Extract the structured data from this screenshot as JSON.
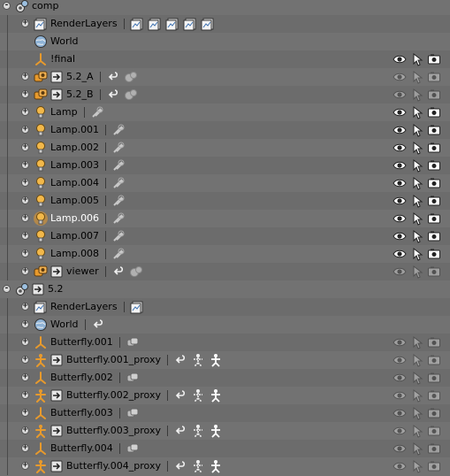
{
  "rows": [
    {
      "label": "comp",
      "depth": 0,
      "expand": "-",
      "icon": "scene",
      "subs": [],
      "ctl": false
    },
    {
      "label": "RenderLayers",
      "depth": 1,
      "expand": "+",
      "icon": "renderlayers",
      "subs": [
        "layer",
        "layer",
        "layer",
        "layer",
        "layer"
      ],
      "ctl": false
    },
    {
      "label": "World",
      "depth": 1,
      "expand": "",
      "icon": "world",
      "subs": [],
      "ctl": false
    },
    {
      "label": "!final",
      "depth": 1,
      "expand": "",
      "icon": "empty",
      "subs": [],
      "ctl": true,
      "dim": false
    },
    {
      "label": "5.2_A",
      "depth": 1,
      "expand": "+",
      "icon": "group",
      "subs": [
        "link",
        "scene-grey"
      ],
      "ctl": true,
      "dim": true,
      "extraicon": "scene-link"
    },
    {
      "label": "5.2_B",
      "depth": 1,
      "expand": "+",
      "icon": "group",
      "subs": [
        "link",
        "scene-grey"
      ],
      "ctl": true,
      "dim": true,
      "extraicon": "scene-link"
    },
    {
      "label": "Lamp",
      "depth": 1,
      "expand": "+",
      "icon": "lamp",
      "subs": [
        "lampdata"
      ],
      "ctl": true,
      "dim": false
    },
    {
      "label": "Lamp.001",
      "depth": 1,
      "expand": "+",
      "icon": "lamp",
      "subs": [
        "lampdata"
      ],
      "ctl": true,
      "dim": false
    },
    {
      "label": "Lamp.002",
      "depth": 1,
      "expand": "+",
      "icon": "lamp",
      "subs": [
        "lampdata"
      ],
      "ctl": true,
      "dim": false
    },
    {
      "label": "Lamp.003",
      "depth": 1,
      "expand": "+",
      "icon": "lamp",
      "subs": [
        "lampdata"
      ],
      "ctl": true,
      "dim": false
    },
    {
      "label": "Lamp.004",
      "depth": 1,
      "expand": "+",
      "icon": "lamp",
      "subs": [
        "lampdata"
      ],
      "ctl": true,
      "dim": false
    },
    {
      "label": "Lamp.005",
      "depth": 1,
      "expand": "+",
      "icon": "lamp",
      "subs": [
        "lampdata"
      ],
      "ctl": true,
      "dim": false
    },
    {
      "label": "Lamp.006",
      "depth": 1,
      "expand": "+",
      "icon": "lamp",
      "subs": [
        "lampdata"
      ],
      "ctl": true,
      "dim": false,
      "selected": true
    },
    {
      "label": "Lamp.007",
      "depth": 1,
      "expand": "+",
      "icon": "lamp",
      "subs": [
        "lampdata"
      ],
      "ctl": true,
      "dim": false
    },
    {
      "label": "Lamp.008",
      "depth": 1,
      "expand": "+",
      "icon": "lamp",
      "subs": [
        "lampdata"
      ],
      "ctl": true,
      "dim": false
    },
    {
      "label": "viewer",
      "depth": 1,
      "expand": "+",
      "icon": "group",
      "subs": [
        "link",
        "scene-grey"
      ],
      "ctl": true,
      "dim": true,
      "extraicon": "scene-link"
    },
    {
      "label": "5.2",
      "depth": 0,
      "expand": "-",
      "icon": "scene",
      "subs": [],
      "ctl": false,
      "extraicon": "scene-link"
    },
    {
      "label": "RenderLayers",
      "depth": 1,
      "expand": "+",
      "icon": "renderlayers",
      "subs": [
        "layer"
      ],
      "ctl": false
    },
    {
      "label": "World",
      "depth": 1,
      "expand": "+",
      "icon": "world",
      "subs": [
        "link"
      ],
      "ctl": false
    },
    {
      "label": "Butterfly.001",
      "depth": 1,
      "expand": "+",
      "icon": "empty",
      "subs": [
        "group-data"
      ],
      "ctl": true,
      "dim": true
    },
    {
      "label": "Butterfly.001_proxy",
      "depth": 1,
      "expand": "+",
      "icon": "armature",
      "subs": [
        "link",
        "armdata",
        "armpose"
      ],
      "ctl": true,
      "dim": true,
      "extraicon": "scene-link"
    },
    {
      "label": "Butterfly.002",
      "depth": 1,
      "expand": "+",
      "icon": "empty",
      "subs": [
        "group-data"
      ],
      "ctl": true,
      "dim": true
    },
    {
      "label": "Butterfly.002_proxy",
      "depth": 1,
      "expand": "+",
      "icon": "armature",
      "subs": [
        "link",
        "armdata",
        "armpose"
      ],
      "ctl": true,
      "dim": true,
      "extraicon": "scene-link"
    },
    {
      "label": "Butterfly.003",
      "depth": 1,
      "expand": "+",
      "icon": "empty",
      "subs": [
        "group-data"
      ],
      "ctl": true,
      "dim": true
    },
    {
      "label": "Butterfly.003_proxy",
      "depth": 1,
      "expand": "+",
      "icon": "armature",
      "subs": [
        "link",
        "armdata",
        "armpose"
      ],
      "ctl": true,
      "dim": true,
      "extraicon": "scene-link"
    },
    {
      "label": "Butterfly.004",
      "depth": 1,
      "expand": "+",
      "icon": "empty",
      "subs": [
        "group-data"
      ],
      "ctl": true,
      "dim": true
    },
    {
      "label": "Butterfly.004_proxy",
      "depth": 1,
      "expand": "+",
      "icon": "armature",
      "subs": [
        "link",
        "armdata",
        "armpose"
      ],
      "ctl": true,
      "dim": true,
      "extraicon": "scene-link"
    }
  ],
  "colors": {
    "bg_odd": "#727272",
    "bg_even": "#6c6c6c",
    "orange": "#e89a2c",
    "selected_text": "#ffffff"
  }
}
